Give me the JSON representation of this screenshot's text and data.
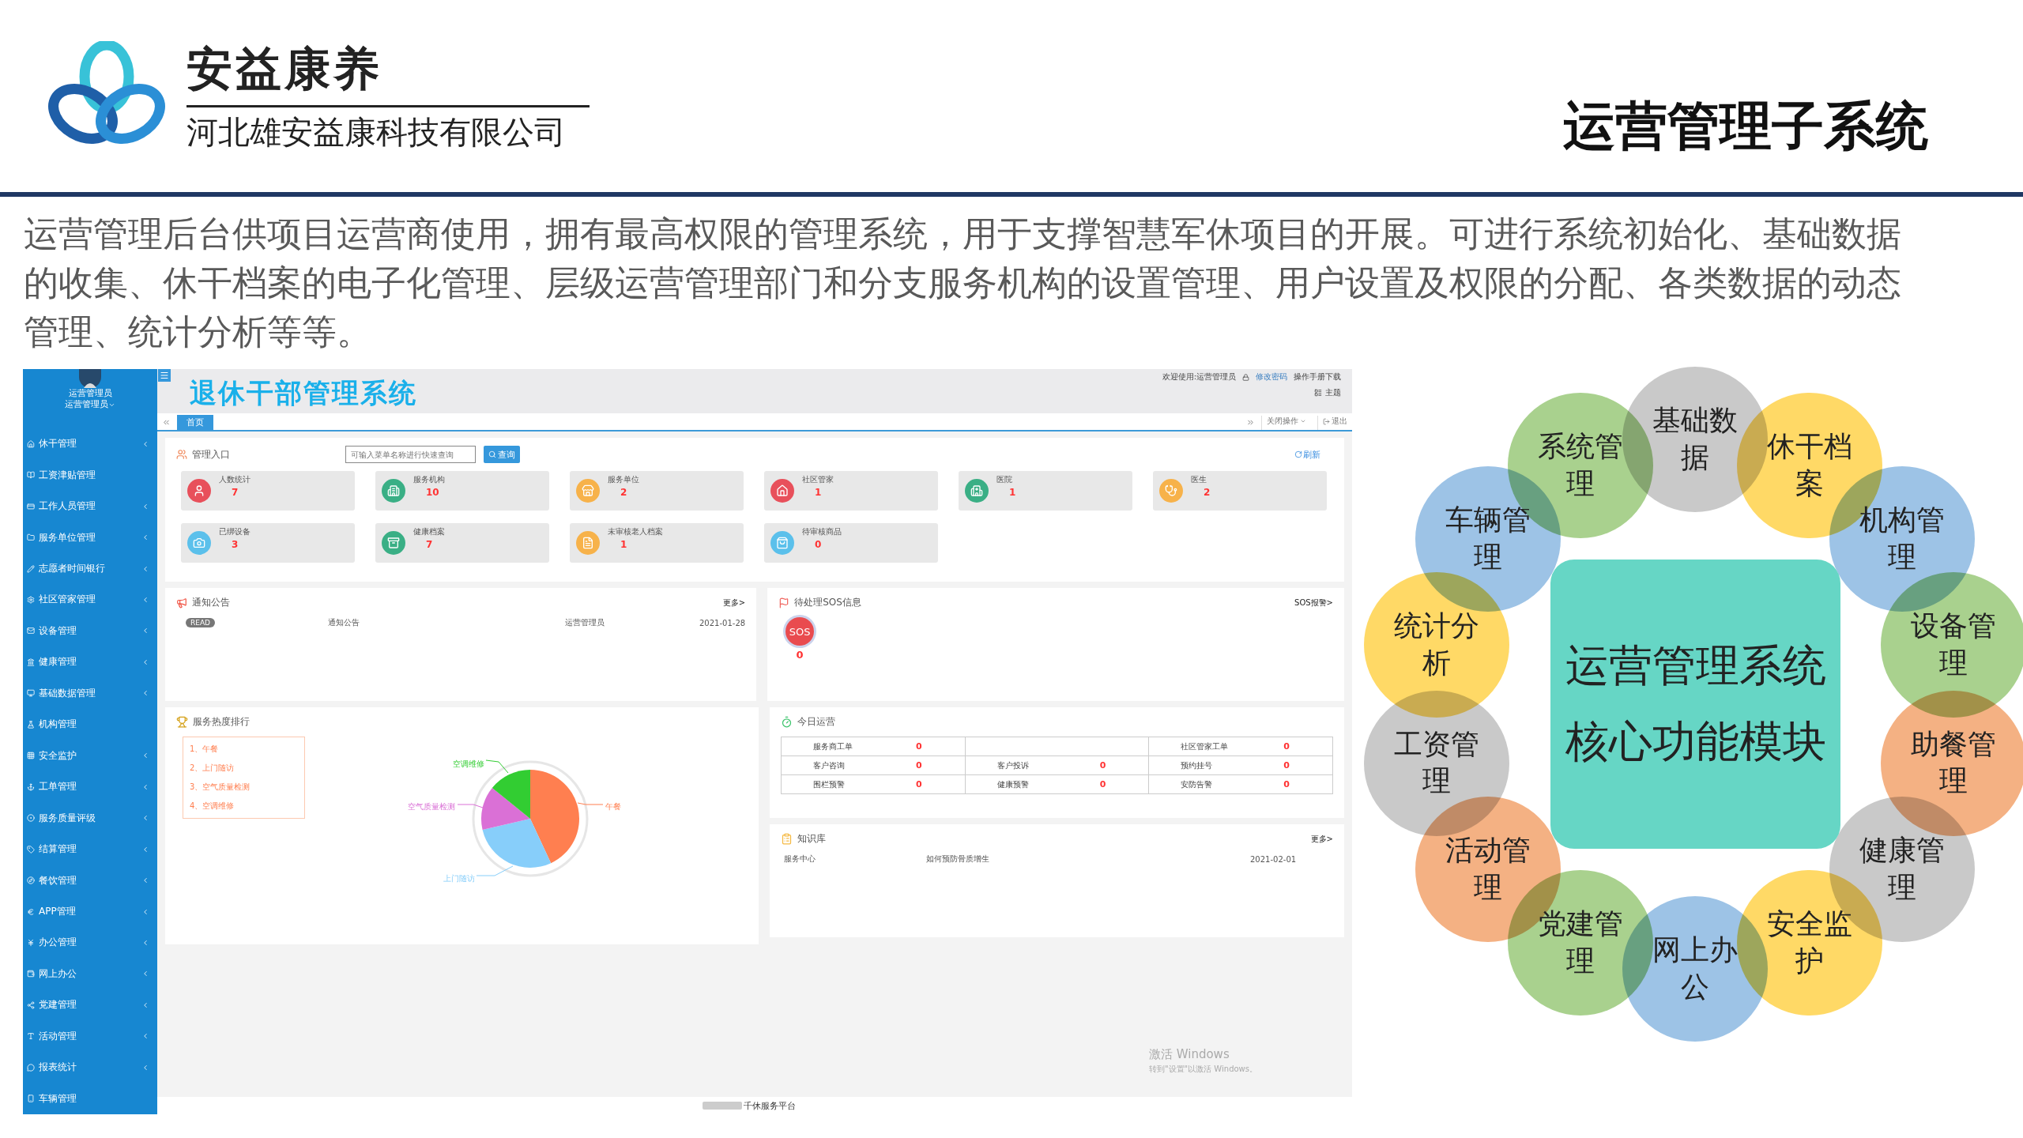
{
  "slide": {
    "brand": "安益康养",
    "company": "河北雄安益康科技有限公司",
    "title": "运营管理子系统",
    "description": "运营管理后台供项目运营商使用，拥有最高权限的管理系统，用于支撑智慧军休项目的开展。可进行系统初始化、基础数据的收集、休干档案的电子化管理、层级运营管理部门和分支服务机构的设置管理、用户设置及权限的分配、各类数据的动态管理、统计分析等等。"
  },
  "app": {
    "sidebar": {
      "user": {
        "name": "运营管理员",
        "role": "运营管理员"
      },
      "items": [
        {
          "label": "休干管理",
          "expandable": true
        },
        {
          "label": "工资津贴管理",
          "expandable": false
        },
        {
          "label": "工作人员管理",
          "expandable": true
        },
        {
          "label": "服务单位管理",
          "expandable": true
        },
        {
          "label": "志愿者时间银行",
          "expandable": true
        },
        {
          "label": "社区管家管理",
          "expandable": true
        },
        {
          "label": "设备管理",
          "expandable": true
        },
        {
          "label": "健康管理",
          "expandable": true
        },
        {
          "label": "基础数据管理",
          "expandable": true
        },
        {
          "label": "机构管理",
          "expandable": false
        },
        {
          "label": "安全监护",
          "expandable": true
        },
        {
          "label": "工单管理",
          "expandable": true
        },
        {
          "label": "服务质量评级",
          "expandable": true
        },
        {
          "label": "结算管理",
          "expandable": true
        },
        {
          "label": "餐饮管理",
          "expandable": true
        },
        {
          "label": "APP管理",
          "expandable": true
        },
        {
          "label": "办公管理",
          "expandable": true
        },
        {
          "label": "网上办公",
          "expandable": true
        },
        {
          "label": "党建管理",
          "expandable": true
        },
        {
          "label": "活动管理",
          "expandable": true
        },
        {
          "label": "报表统计",
          "expandable": true
        },
        {
          "label": "车辆管理",
          "expandable": false
        }
      ]
    },
    "header": {
      "title": "退休干部管理系统",
      "welcome": "欢迎使用:运营管理员",
      "change_password": "修改密码",
      "manual": "操作手册下载",
      "theme": "主题"
    },
    "tabs": [
      {
        "label": "首页",
        "selected": true
      }
    ],
    "tab_actions": {
      "close": "关闭操作",
      "logout": "退出"
    },
    "entry_panel": {
      "title": "管理入口",
      "search": {
        "placeholder": "可输入菜单名称进行快速查询"
      },
      "search_button": "查询",
      "refresh": "刷新",
      "cards": [
        {
          "label": "人数统计",
          "value": "7",
          "color": "#e8505b"
        },
        {
          "label": "服务机构",
          "value": "10",
          "color": "#3aaf85"
        },
        {
          "label": "服务单位",
          "value": "2",
          "color": "#f7b24a"
        },
        {
          "label": "社区管家",
          "value": "1",
          "color": "#e8505b"
        },
        {
          "label": "医院",
          "value": "1",
          "color": "#3aaf85"
        },
        {
          "label": "医生",
          "value": "2",
          "color": "#f7b24a"
        },
        {
          "label": "已绑设备",
          "value": "3",
          "color": "#5bc0eb"
        },
        {
          "label": "健康档案",
          "value": "7",
          "color": "#3aaf85"
        },
        {
          "label": "未审核老人档案",
          "value": "1",
          "color": "#f7b24a"
        },
        {
          "label": "待审核商品",
          "value": "0",
          "color": "#5bc0eb"
        }
      ]
    },
    "notice_panel": {
      "title": "通知公告",
      "more": "更多>",
      "rows": [
        {
          "badge": "READ",
          "title": "通知公告",
          "author": "运营管理员",
          "date": "2021-01-28"
        }
      ]
    },
    "sos_panel": {
      "title": "待处理SOS信息",
      "link": "SOS报警>",
      "badge": "SOS",
      "count": "0"
    },
    "ranking_panel": {
      "title": "服务热度排行",
      "items": [
        "1、午餐",
        "2、上门随访",
        "3、空气质量检测",
        "4、空调维修"
      ],
      "chart_labels": [
        {
          "label": "午餐",
          "color": "#ff7f50"
        },
        {
          "label": "上门随访",
          "color": "#87cefa"
        },
        {
          "label": "空气质量检测",
          "color": "#da70d6"
        },
        {
          "label": "空调维修",
          "color": "#32cd32"
        }
      ]
    },
    "today_panel": {
      "title": "今日运营",
      "rows": [
        [
          {
            "kind": "stat",
            "label": "服务商工单",
            "value": "0"
          },
          {
            "kind": "empty"
          },
          {
            "kind": "stat",
            "label": "社区管家工单",
            "value": "0"
          }
        ],
        [
          {
            "kind": "stat",
            "label": "客户咨询",
            "value": "0"
          },
          {
            "kind": "stat",
            "label": "客户投诉",
            "value": "0"
          },
          {
            "kind": "stat",
            "label": "预约挂号",
            "value": "0"
          }
        ],
        [
          {
            "kind": "stat",
            "label": "围栏预警",
            "value": "0"
          },
          {
            "kind": "stat",
            "label": "健康预警",
            "value": "0"
          },
          {
            "kind": "stat",
            "label": "安防告警",
            "value": "0"
          }
        ]
      ]
    },
    "knowledge_panel": {
      "title": "知识库",
      "more": "更多>",
      "rows": [
        {
          "category": "服务中心",
          "title": "如何预防骨质增生",
          "date": "2021-02-01"
        }
      ]
    },
    "windows_notice": {
      "title": "激活 Windows",
      "subtitle": "转到\"设置\"以激活 Windows。"
    },
    "footer": "千休服务平台"
  },
  "diagram": {
    "center": [
      "运营管理系统",
      "核心功能模块"
    ],
    "right_arc": [
      {
        "label": "基础数据",
        "color": "#c9c9c9"
      },
      {
        "label": "休干档案",
        "color": "#ffd966"
      },
      {
        "label": "机构管理",
        "color": "#9dc3e6"
      },
      {
        "label": "设备管理",
        "color": "#a9d18e"
      },
      {
        "label": "助餐管理",
        "color": "#f4b183"
      },
      {
        "label": "健康管理",
        "color": "#c9c9c9"
      },
      {
        "label": "安全监护",
        "color": "#ffd966"
      },
      {
        "label": "网上办公",
        "color": "#9dc3e6"
      }
    ],
    "left_arc": [
      {
        "label": "系统管理",
        "color": "#a9d18e"
      },
      {
        "label": "车辆管理",
        "color": "#9dc3e6"
      },
      {
        "label": "统计分析",
        "color": "#ffd966"
      },
      {
        "label": "工资管理",
        "color": "#c9c9c9"
      },
      {
        "label": "活动管理",
        "color": "#f4b183"
      },
      {
        "label": "党建管理",
        "color": "#a9d18e"
      }
    ]
  }
}
